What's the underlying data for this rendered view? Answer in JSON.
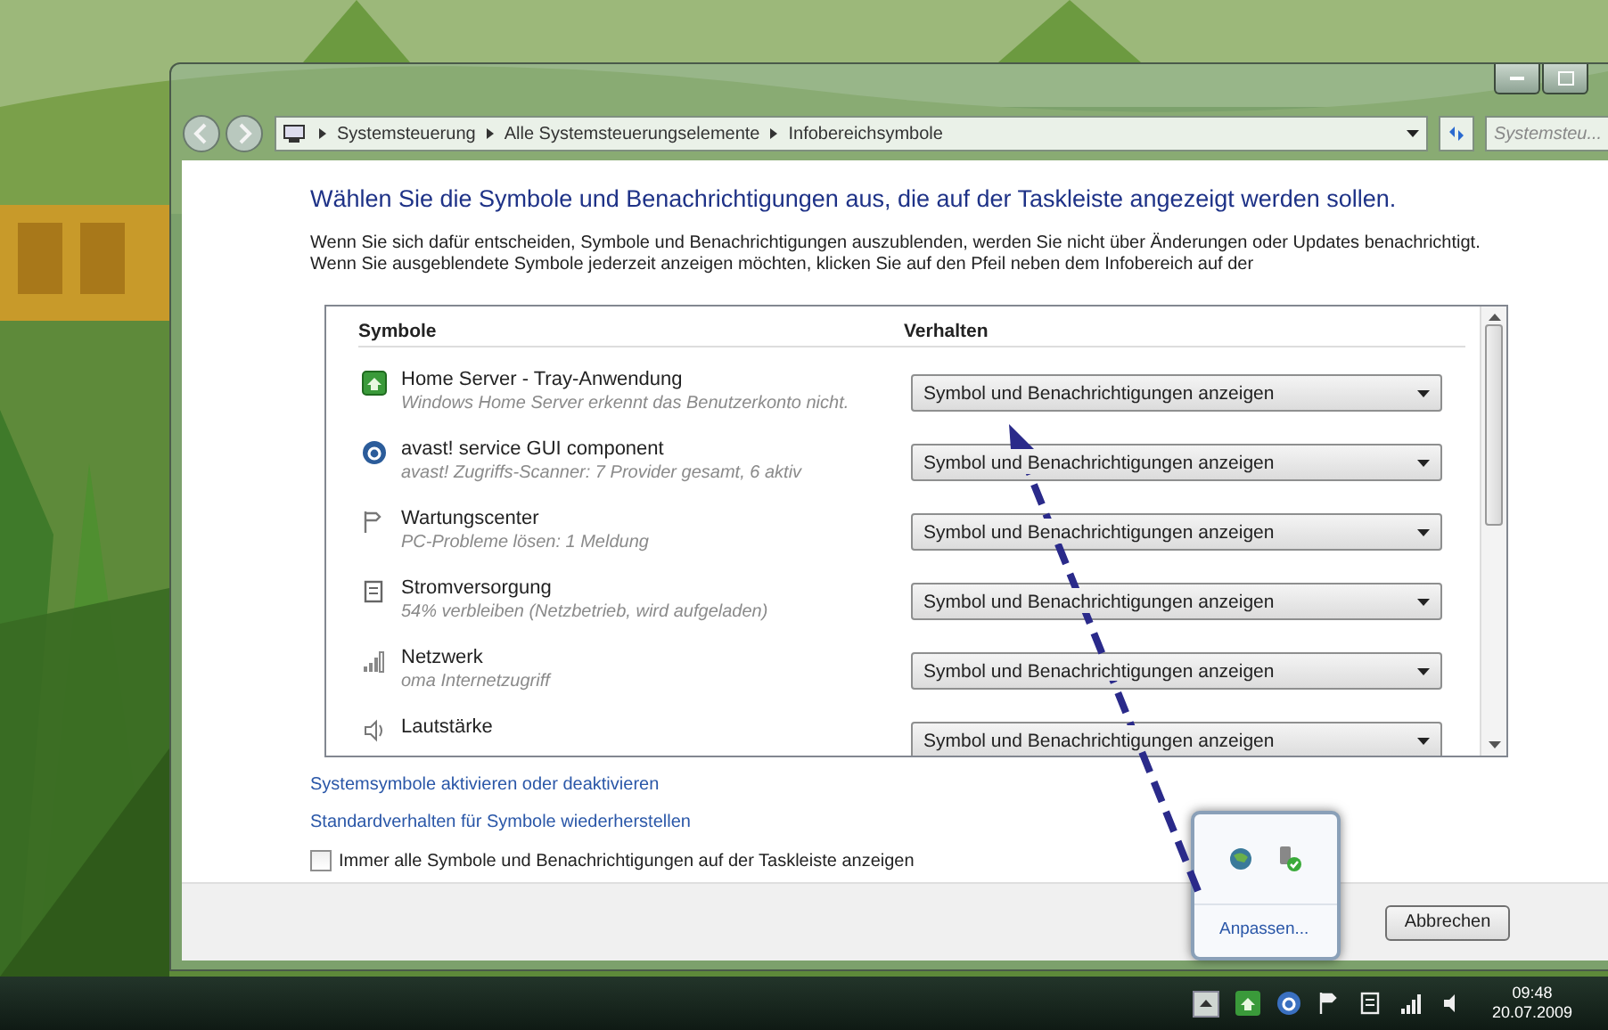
{
  "window": {
    "breadcrumb": [
      "Systemsteuerung",
      "Alle Systemsteuerungselemente",
      "Infobereichsymbole"
    ],
    "search": {
      "placeholder": "Systemsteu..."
    },
    "heading": "Wählen Sie die Symbole und Benachrichtigungen aus, die auf der Taskleiste angezeigt werden sollen.",
    "description": "Wenn Sie sich dafür entscheiden, Symbole und Benachrichtigungen auszublenden, werden Sie nicht über Änderungen oder Updates benachrichtigt. Wenn Sie ausgeblendete Symbole jederzeit anzeigen möchten, klicken Sie auf den Pfeil neben dem Infobereich auf der",
    "table": {
      "columns": [
        "Symbole",
        "Verhalten"
      ],
      "rows": [
        {
          "kind": "homeserver",
          "name": "Home Server - Tray-Anwendung",
          "detail": "Windows Home Server erkennt das Benutzerkonto nicht.",
          "behavior": "Symbol und Benachrichtigungen anzeigen"
        },
        {
          "kind": "avast",
          "name": "avast! service GUI component",
          "detail": "avast! Zugriffs-Scanner: 7 Provider gesamt, 6 aktiv",
          "behavior": "Symbol und Benachrichtigungen anzeigen"
        },
        {
          "kind": "flag",
          "name": "Wartungscenter",
          "detail": "PC-Probleme lösen: 1 Meldung",
          "behavior": "Symbol und Benachrichtigungen anzeigen"
        },
        {
          "kind": "power",
          "name": "Stromversorgung",
          "detail": "54% verbleiben (Netzbetrieb, wird aufgeladen)",
          "behavior": "Symbol und Benachrichtigungen anzeigen"
        },
        {
          "kind": "network",
          "name": "Netzwerk",
          "detail": "oma Internetzugriff",
          "behavior": "Symbol und Benachrichtigungen anzeigen"
        },
        {
          "kind": "volume",
          "name": "Lautstärke",
          "behavior": "Symbol und Benachrichtigungen anzeigen"
        }
      ]
    },
    "links": [
      "Systemsymbole aktivieren oder deaktivieren",
      "Standardverhalten für Symbole wiederherstellen"
    ],
    "checkbox": {
      "label": "Immer alle Symbole und Benachrichtigungen auf der Taskleiste anzeigen",
      "checked": false
    },
    "buttons": [
      "Abbrechen"
    ]
  },
  "tray_popup": {
    "link": "Anpassen..."
  },
  "taskbar": {
    "time": "09:48",
    "date": "20.07.2009"
  }
}
